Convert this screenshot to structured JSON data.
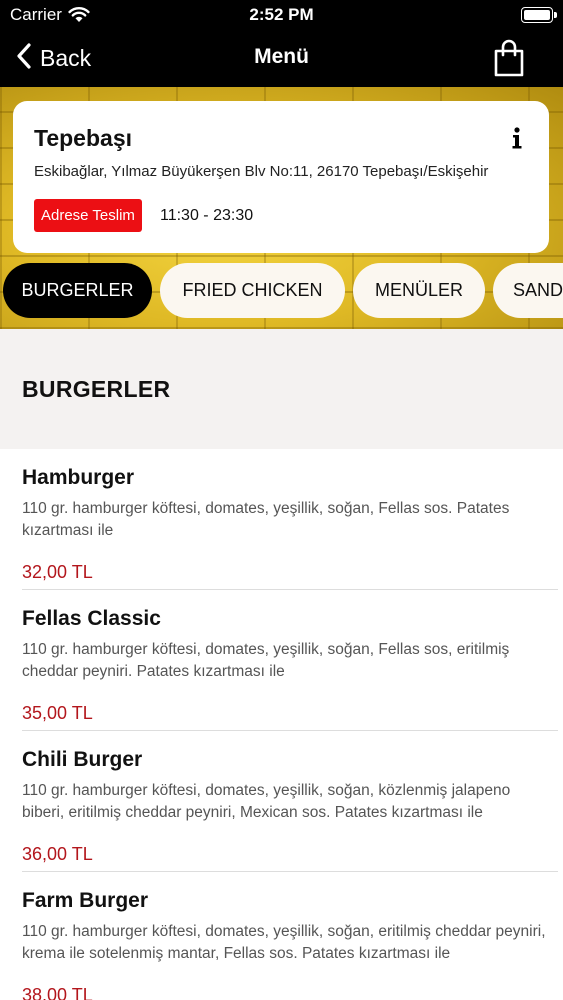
{
  "status_bar": {
    "carrier": "Carrier",
    "time": "2:52 PM"
  },
  "nav": {
    "back_label": "Back",
    "title": "Menü"
  },
  "restaurant": {
    "name": "Tepebaşı",
    "address": "Eskibağlar, Yılmaz Büyükerşen Blv No:11, 26170 Tepebaşı/Eskişehir",
    "delivery_badge": "Adrese Teslim",
    "hours": "11:30 - 23:30"
  },
  "tabs": [
    {
      "label": "BURGERLER",
      "active": true
    },
    {
      "label": "FRIED CHICKEN",
      "active": false
    },
    {
      "label": "MENÜLER",
      "active": false
    },
    {
      "label": "SAND",
      "active": false
    }
  ],
  "section": {
    "title": "BURGERLER"
  },
  "menu_items": [
    {
      "name": "Hamburger",
      "description": "110 gr. hamburger köftesi, domates, yeşillik, soğan, Fellas sos. Patates kızartması ile",
      "price": "32,00 TL"
    },
    {
      "name": "Fellas Classic",
      "description": "110 gr. hamburger köftesi, domates, yeşillik, soğan, Fellas sos, eritilmiş cheddar peyniri. Patates kızartması ile",
      "price": "35,00 TL"
    },
    {
      "name": "Chili Burger",
      "description": "110 gr. hamburger köftesi, domates, yeşillik, soğan, közlenmiş jalapeno biberi, eritilmiş cheddar peyniri, Mexican sos. Patates kızartması ile",
      "price": "36,00 TL"
    },
    {
      "name": "Farm Burger",
      "description": "110 gr. hamburger köftesi, domates, yeşillik, soğan, eritilmiş cheddar peyniri, krema ile sotelenmiş mantar, Fellas sos. Patates kızartması ile",
      "price": "38,00 TL"
    }
  ],
  "colors": {
    "accent_red": "#ec0f14",
    "price_red": "#b3161c",
    "banner_yellow": "#dfb925"
  },
  "icons": {
    "back": "chevron-left-icon",
    "cart": "shopping-bag-icon",
    "info": "info-icon",
    "wifi": "wifi-icon",
    "battery": "battery-icon"
  }
}
